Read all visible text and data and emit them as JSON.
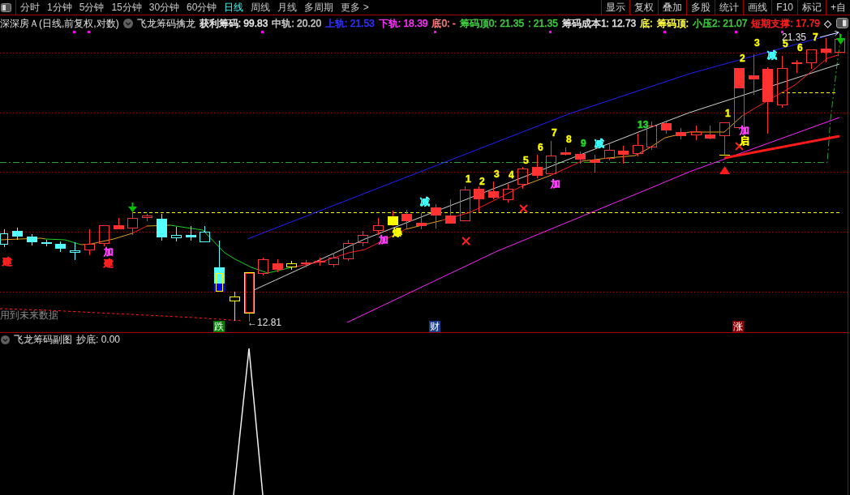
{
  "toolbar": {
    "periods": [
      {
        "label": "分时",
        "selected": false
      },
      {
        "label": "1分钟",
        "selected": false
      },
      {
        "label": "5分钟",
        "selected": false
      },
      {
        "label": "15分钟",
        "selected": false
      },
      {
        "label": "30分钟",
        "selected": false
      },
      {
        "label": "60分钟",
        "selected": false
      },
      {
        "label": "日线",
        "selected": true
      },
      {
        "label": "周线",
        "selected": false
      },
      {
        "label": "月线",
        "selected": false
      },
      {
        "label": "多周期",
        "selected": false
      },
      {
        "label": "更多 >",
        "selected": false
      }
    ],
    "buttons": [
      "显示",
      "复权",
      "叠加",
      "多股",
      "统计",
      "画线",
      "F10",
      "标记",
      "+自"
    ]
  },
  "header": {
    "title": "深深房Ａ(日线,前复权,对数)",
    "indicator": "飞龙筹码擒龙",
    "values": [
      {
        "text": "获利筹码: 99.83",
        "color": "#e8e8e8"
      },
      {
        "text": "中轨: 20.20",
        "color": "#c8c8c8"
      },
      {
        "text": "上轨: 21.53",
        "color": "#3232ff"
      },
      {
        "text": "下轨: 18.39",
        "color": "#ff32ff"
      },
      {
        "text": "底0: -",
        "color": "#ff8080"
      },
      {
        "text": "筹码顶0: 21.35",
        "color": "#40d040"
      },
      {
        "text": ": 21.35",
        "color": "#40d040"
      },
      {
        "text": "筹码成本1: 12.73",
        "color": "#e0e0e0"
      },
      {
        "text": "底:",
        "color": "#ffff40"
      },
      {
        "text": "筹码顶:",
        "color": "#ffff40"
      },
      {
        "text": "小压2: 21.07",
        "color": "#40d040"
      },
      {
        "text": "短期支撑: 17.79",
        "color": "#ff2020"
      },
      {
        "text": "◇",
        "color": "#c8c8c8"
      }
    ]
  },
  "main_chart": {
    "signals": [
      {
        "text": "建",
        "color": "#ff2020"
      },
      {
        "text": "加",
        "color": "#ff40ff"
      },
      {
        "text": "建",
        "color": "#ff2020"
      },
      {
        "text": "加",
        "color": "#ff40ff"
      },
      {
        "text": "爆",
        "color": "#ffff00"
      },
      {
        "text": "减",
        "color": "#40ffff"
      },
      {
        "text": "1",
        "color": "#ffff00"
      },
      {
        "text": "2",
        "color": "#ffff00"
      },
      {
        "text": "3",
        "color": "#ffff00"
      },
      {
        "text": "4",
        "color": "#ffff00"
      },
      {
        "text": "5",
        "color": "#ffff00"
      },
      {
        "text": "6",
        "color": "#ffff00"
      },
      {
        "text": "加",
        "color": "#ff40ff"
      },
      {
        "text": "7",
        "color": "#ffff00"
      },
      {
        "text": "8",
        "color": "#ffff00"
      },
      {
        "text": "9",
        "color": "#20e020"
      },
      {
        "text": "减",
        "color": "#40ffff"
      },
      {
        "text": "13",
        "color": "#20e020"
      },
      {
        "text": "1",
        "color": "#ffff00"
      },
      {
        "text": "2",
        "color": "#ffff00"
      },
      {
        "text": "加",
        "color": "#ff40ff"
      },
      {
        "text": "启",
        "color": "#ffff00"
      },
      {
        "text": "3",
        "color": "#ffff00"
      },
      {
        "text": "减",
        "color": "#40ffff"
      },
      {
        "text": "5",
        "color": "#ffff00"
      },
      {
        "text": "6",
        "color": "#ffff00"
      },
      {
        "text": "7",
        "color": "#ffff00"
      }
    ],
    "price_labels": [
      "←12.81",
      "21.35"
    ],
    "badges": [
      {
        "text": "跌",
        "color": "#008000"
      },
      {
        "text": "财",
        "color": "#1a3a8a"
      },
      {
        "text": "涨",
        "color": "#8b0000"
      }
    ],
    "note": "用到未来数据"
  },
  "sub_chart": {
    "title": "飞龙筹码副图",
    "value": "抄底: 0.00"
  }
}
